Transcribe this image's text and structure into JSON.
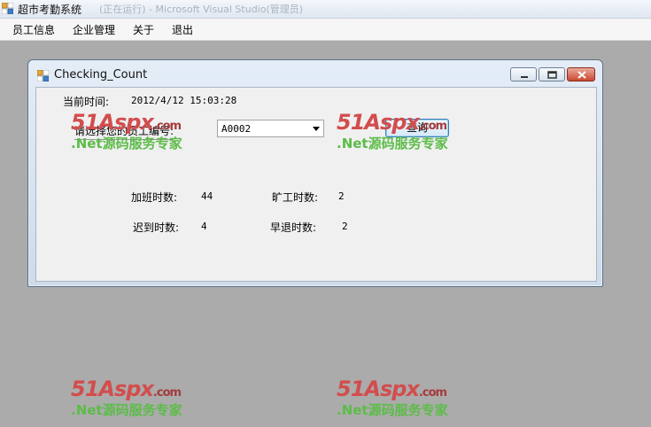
{
  "app": {
    "title": "超市考勤系统",
    "title_ghost": "(正在运行) - Microsoft Visual Studio(管理员)"
  },
  "menu": [
    {
      "label": "员工信息"
    },
    {
      "label": "企业管理"
    },
    {
      "label": "关于"
    },
    {
      "label": "退出"
    }
  ],
  "child": {
    "title": "Checking_Count",
    "current_time_label": "当前时间:",
    "current_time_value": "2012/4/12 15:03:28",
    "employee_select_label": "请选择您的员工编号:",
    "employee_selected": "A0002",
    "query_button": "查询",
    "stats": {
      "overtime_label": "加班时数:",
      "overtime_value": "44",
      "absent_label": "旷工时数:",
      "absent_value": "2",
      "late_label": "迟到时数:",
      "late_value": "4",
      "early_label": "早退时数:",
      "early_value": "2"
    }
  },
  "watermark": {
    "logo": "51Aspx",
    "domain": ".com",
    "tagline": ".Net源码服务专家"
  },
  "colors": {
    "desktop": "#ababab",
    "watermark_red": "#d24d4d",
    "watermark_green": "#5cbc48",
    "close_red": "#c9492f"
  }
}
